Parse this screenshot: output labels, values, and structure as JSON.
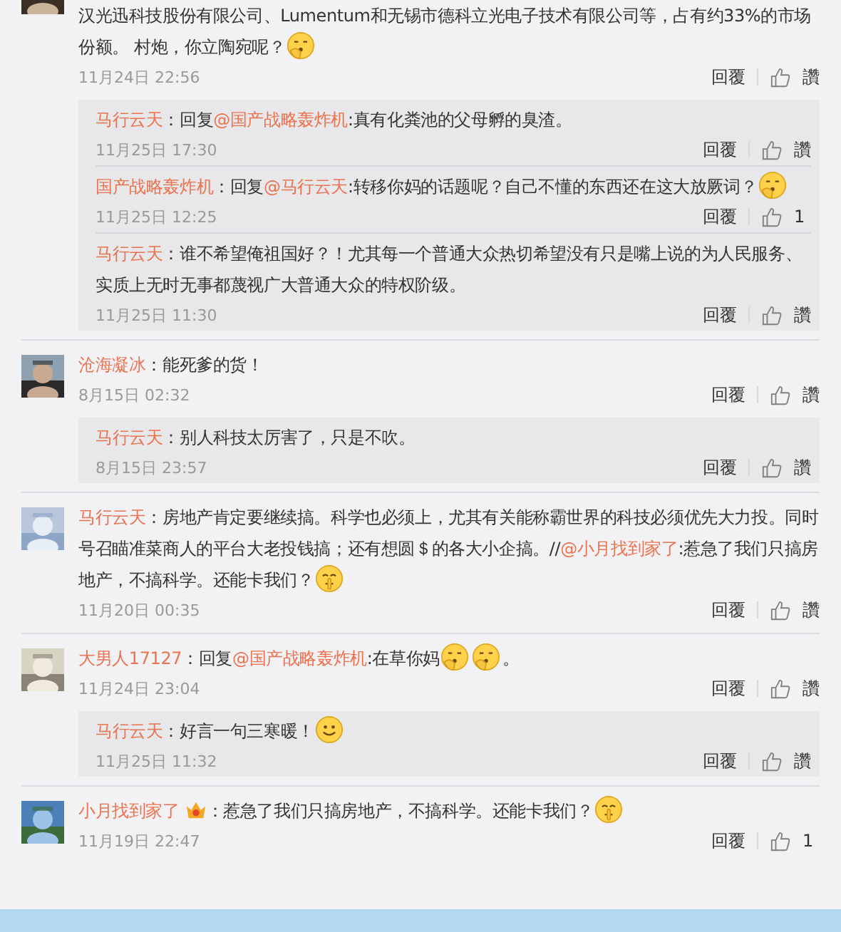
{
  "comments": [
    {
      "cut": true,
      "text": [
        {
          "kind": "text",
          "text": "汉光迅科技股份有限公司、Lumentum和无锡市德科立光电子技术有限公司等，占有约33%的市场份额。 村炮，你立陶宛呢？"
        },
        {
          "kind": "think"
        }
      ],
      "time": "11月24日 22:56",
      "reply": "回覆",
      "like": "讚",
      "replies": [
        {
          "user": "马行云天",
          "text": [
            {
              "kind": "text",
              "text": "：回复"
            },
            {
              "kind": "mention",
              "text": "@国产战略轰炸机"
            },
            {
              "kind": "text",
              "text": ":真有化粪池的父母孵的臭渣。"
            }
          ],
          "time": "11月25日 17:30",
          "reply": "回覆",
          "like": "讚"
        },
        {
          "user": "国产战略轰炸机",
          "text": [
            {
              "kind": "text",
              "text": "：回复"
            },
            {
              "kind": "mention",
              "text": "@马行云天"
            },
            {
              "kind": "text",
              "text": ":转移你妈的话题呢？自己不懂的东西还在这大放厥词？"
            },
            {
              "kind": "think"
            }
          ],
          "time": "11月25日 12:25",
          "reply": "回覆",
          "like": "1"
        },
        {
          "user": "马行云天",
          "text": [
            {
              "kind": "text",
              "text": "：谁不希望俺祖国好？！尤其每一个普通大众热切希望没有只是嘴上说的为人民服务、实质上无时无事都蔑视广大普通大众的特权阶级。"
            }
          ],
          "time": "11月25日 11:30",
          "reply": "回覆",
          "like": "讚"
        }
      ]
    },
    {
      "user": "沧海凝冰",
      "text": [
        {
          "kind": "text",
          "text": "：能死爹的货！"
        }
      ],
      "time": "8月15日 02:32",
      "reply": "回覆",
      "like": "讚",
      "replies": [
        {
          "user": "马行云天",
          "text": [
            {
              "kind": "text",
              "text": "：别人科技太厉害了，只是不吹。"
            }
          ],
          "time": "8月15日 23:57",
          "reply": "回覆",
          "like": "讚"
        }
      ]
    },
    {
      "user": "马行云天",
      "text": [
        {
          "kind": "text",
          "text": "：房地产肯定要继续搞。科学也必须上，尤其有关能称霸世界的科技必须优先大力投。同时号召瞄准菜商人的平台大老投钱搞；还有想圆＄的各大小企搞。//"
        },
        {
          "kind": "mention",
          "text": "@小月找到家了"
        },
        {
          "kind": "text",
          "text": ":惹急了我们只搞房地产，不搞科学。还能卡我们？"
        },
        {
          "kind": "hush"
        }
      ],
      "time": "11月20日 00:35",
      "reply": "回覆",
      "like": "讚"
    },
    {
      "user": "大男人17127",
      "text": [
        {
          "kind": "text",
          "text": "：回复"
        },
        {
          "kind": "mention",
          "text": "@国产战略轰炸机"
        },
        {
          "kind": "text",
          "text": ":在草你妈"
        },
        {
          "kind": "think"
        },
        {
          "kind": "think"
        },
        {
          "kind": "text",
          "text": "。"
        }
      ],
      "time": "11月24日 23:04",
      "reply": "回覆",
      "like": "讚",
      "replies": [
        {
          "user": "马行云天",
          "text": [
            {
              "kind": "text",
              "text": "：好言一句三寒暖！"
            },
            {
              "kind": "smile"
            }
          ],
          "time": "11月25日 11:32",
          "reply": "回覆",
          "like": "讚"
        }
      ]
    },
    {
      "user": "小月找到家了",
      "badge": true,
      "text": [
        {
          "kind": "text",
          "text": "：惹急了我们只搞房地产，不搞科学。还能卡我们？"
        },
        {
          "kind": "hush"
        }
      ],
      "time": "11月19日 22:47",
      "reply": "回覆",
      "like": "1"
    }
  ]
}
